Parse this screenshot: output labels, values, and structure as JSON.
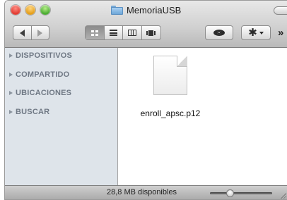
{
  "window": {
    "title": "MemoriaUSB",
    "title_icon": "folder-icon"
  },
  "toolbar": {
    "back_icon": "back-arrow-icon",
    "forward_icon": "forward-arrow-icon",
    "view_modes": [
      "icon-view-icon",
      "list-view-icon",
      "column-view-icon",
      "coverflow-view-icon"
    ],
    "active_view": "icon-view",
    "quicklook_icon": "eye-icon",
    "action_icon": "gear-icon",
    "overflow_label": "»"
  },
  "sidebar": {
    "sections": [
      {
        "label": "DISPOSITIVOS"
      },
      {
        "label": "COMPARTIDO"
      },
      {
        "label": "UBICACIONES"
      },
      {
        "label": "BUSCAR"
      }
    ]
  },
  "content": {
    "files": [
      {
        "name": "enroll_apsc.p12",
        "icon": "document-icon"
      }
    ]
  },
  "statusbar": {
    "text": "28,8 MB disponibles",
    "zoom_level": 0.3
  },
  "colors": {
    "sidebar_bg": "#dee4ea",
    "sidebar_text": "#6f7884",
    "close": "#e0362d",
    "minimize": "#e39b13",
    "zoom": "#43a82a"
  }
}
